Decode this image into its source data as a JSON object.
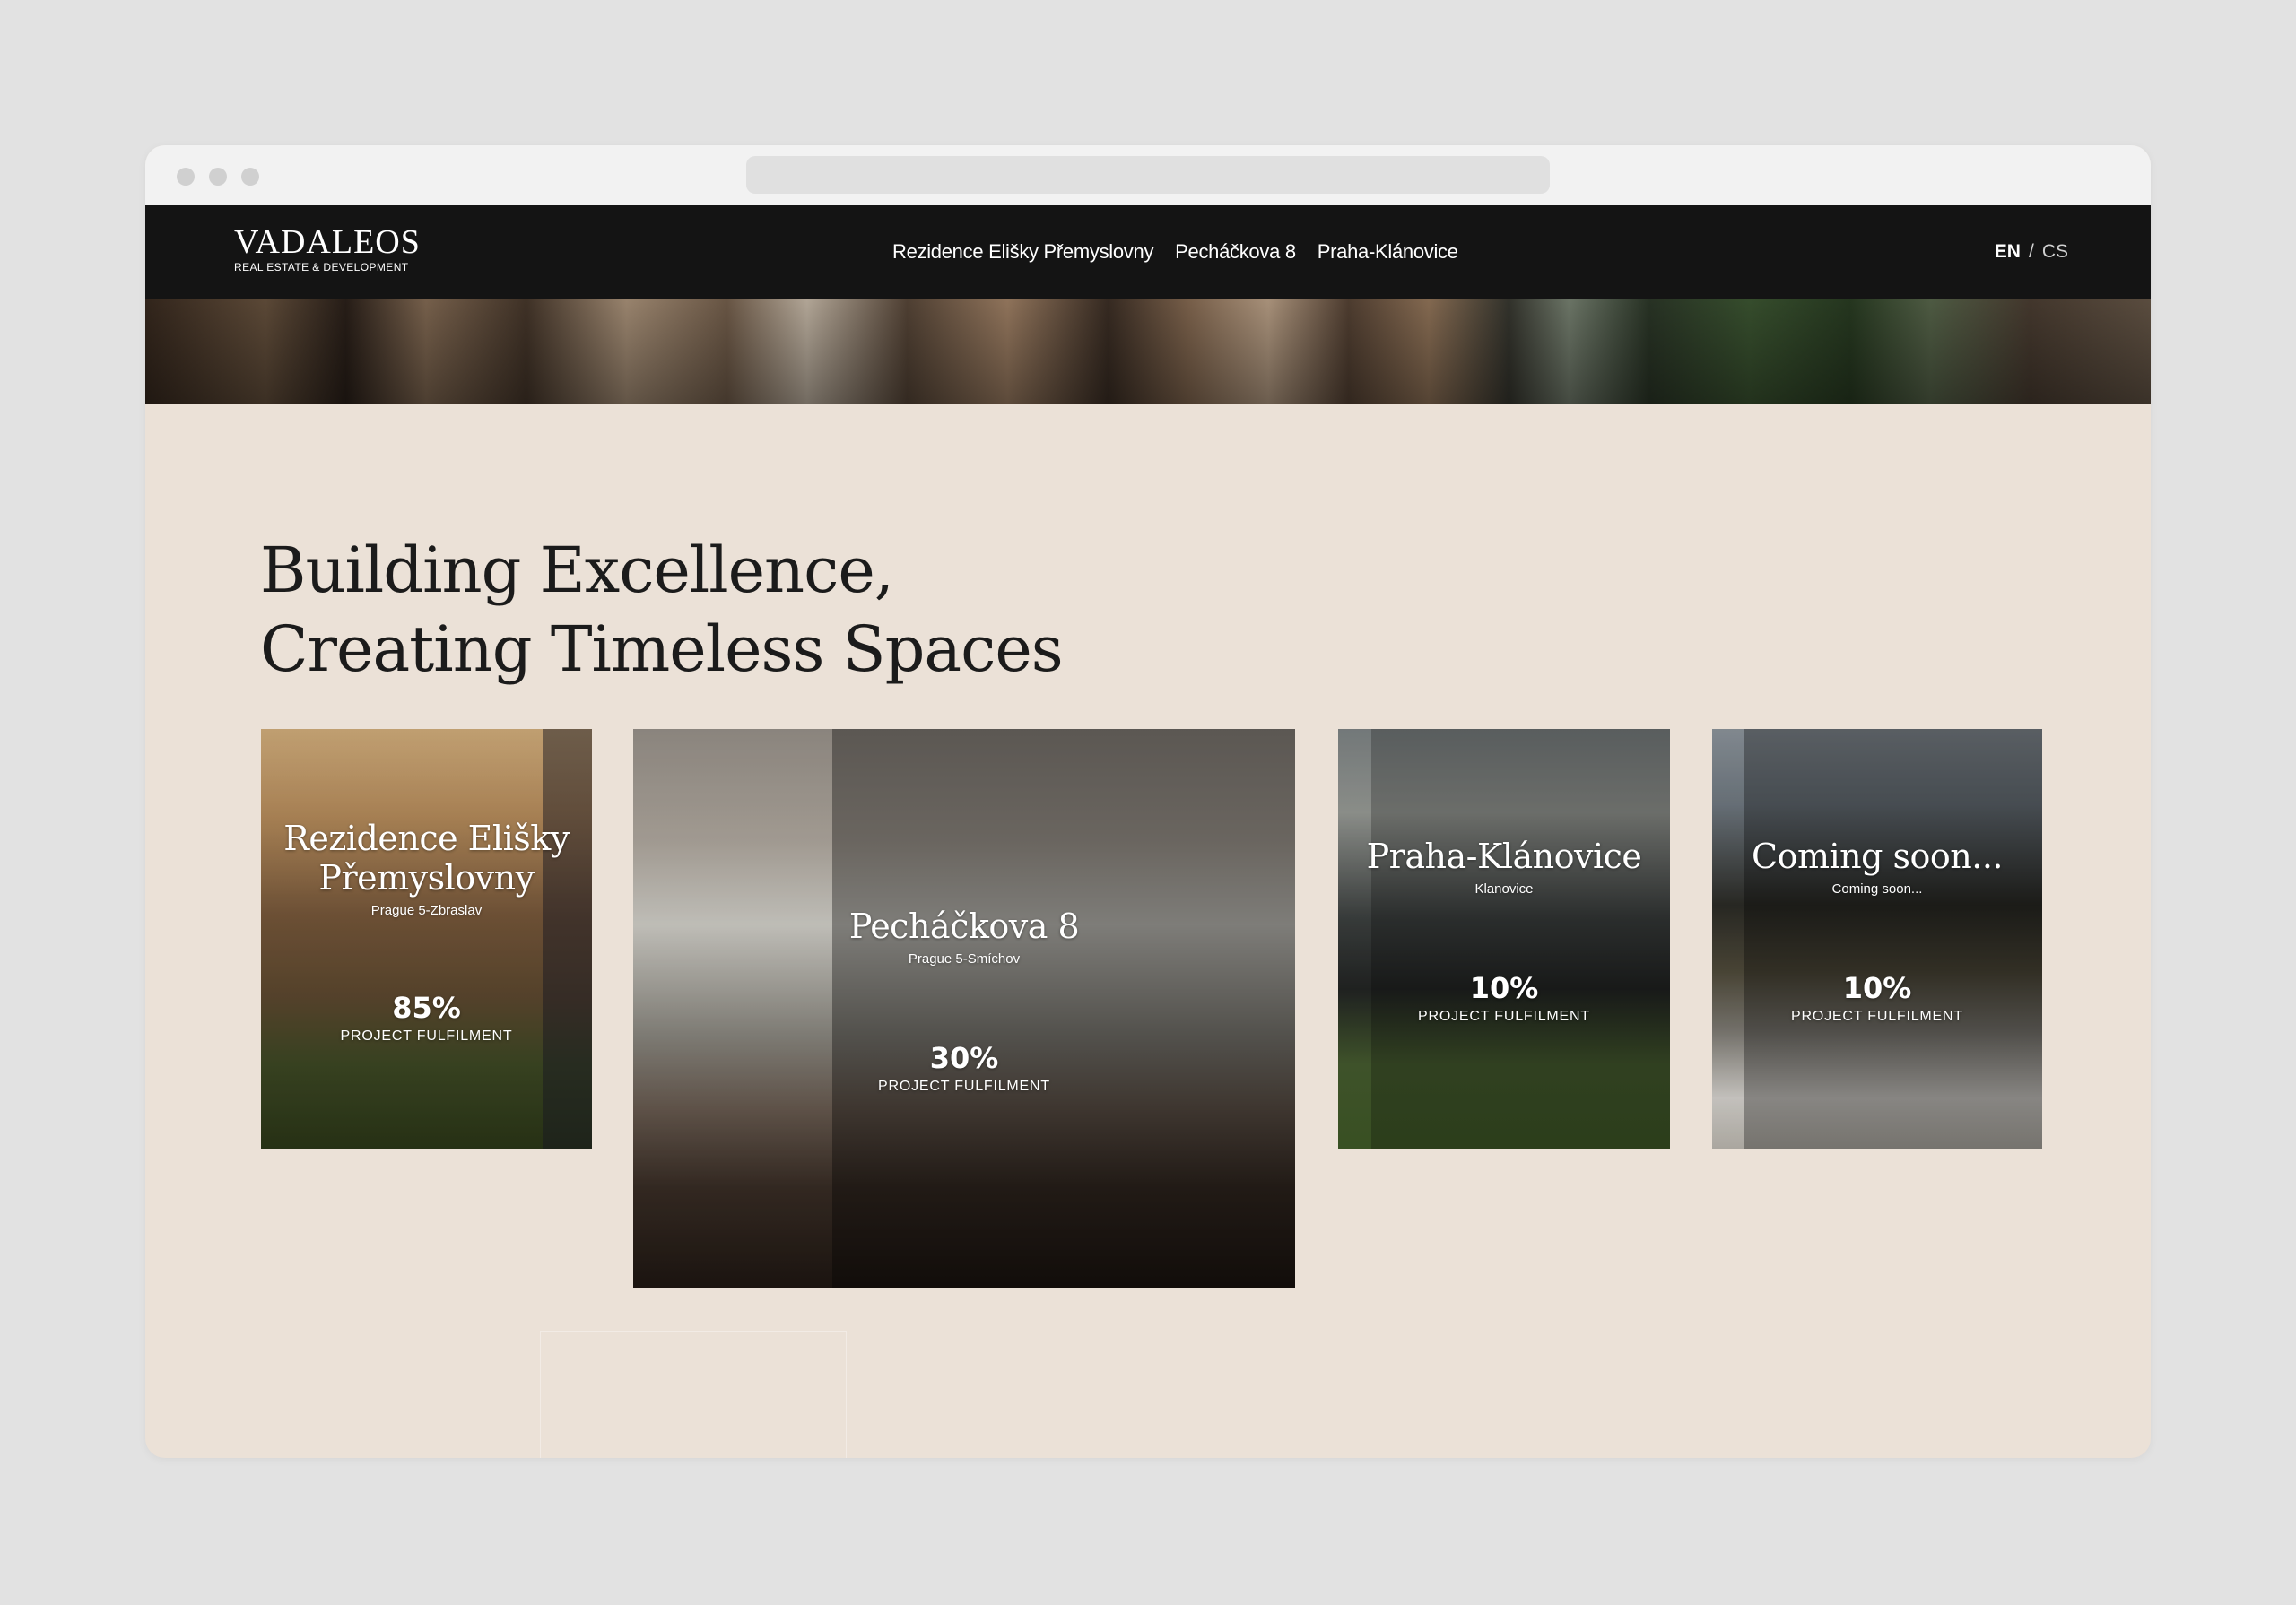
{
  "header": {
    "logo_main": "VADALEOS",
    "logo_sub": "REAL ESTATE & DEVELOPMENT",
    "nav": [
      {
        "label": "Rezidence Elišky Přemyslovny"
      },
      {
        "label": "Pecháčkova 8"
      },
      {
        "label": "Praha-Klánovice"
      }
    ],
    "lang_active": "EN",
    "lang_separator": "/",
    "lang_other": "CS"
  },
  "hero": {
    "line1": "Building Excellence,",
    "line2": "Creating Timeless Spaces"
  },
  "projects": [
    {
      "title": "Rezidence Elišky Přemyslovny",
      "location": "Prague 5-Zbraslav",
      "percent": "85%",
      "percent_label": "PROJECT FULFILMENT",
      "fulfilment": 0.85
    },
    {
      "title": "Pecháčkova 8",
      "location": "Prague 5-Smíchov",
      "percent": "30%",
      "percent_label": "PROJECT FULFILMENT",
      "fulfilment": 0.3
    },
    {
      "title": "Praha-Klánovice",
      "location": "Klanovice",
      "percent": "10%",
      "percent_label": "PROJECT FULFILMENT",
      "fulfilment": 0.1
    },
    {
      "title": "Coming soon...",
      "location": "Coming soon...",
      "percent": "10%",
      "percent_label": "PROJECT FULFILMENT",
      "fulfilment": 0.1
    }
  ],
  "colors": {
    "header_bg": "#141414",
    "page_bg": "#ebe1d7",
    "headline": "#1b1b1b"
  }
}
